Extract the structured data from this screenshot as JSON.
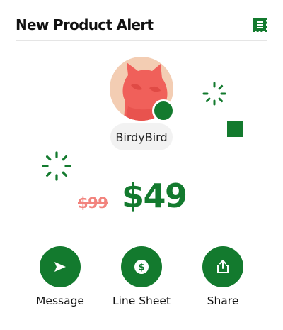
{
  "header": {
    "title": "New Product Alert",
    "menu_icon": "hamburger-menu-icon"
  },
  "profile": {
    "username": "BirdyBird",
    "avatar_icon": "cat-figure-avatar"
  },
  "pricing": {
    "old_price": "$99",
    "new_price": "$49"
  },
  "actions": [
    {
      "label": "Message",
      "icon": "send-icon"
    },
    {
      "label": "Line Sheet",
      "icon": "dollar-icon"
    },
    {
      "label": "Share",
      "icon": "share-icon"
    }
  ],
  "colors": {
    "accent": "#137a2e",
    "old_price": "#f2837d",
    "avatar_bg": "#f3cdb3",
    "avatar_figure": "#f0605a",
    "pill_bg": "#f2f2f2"
  }
}
